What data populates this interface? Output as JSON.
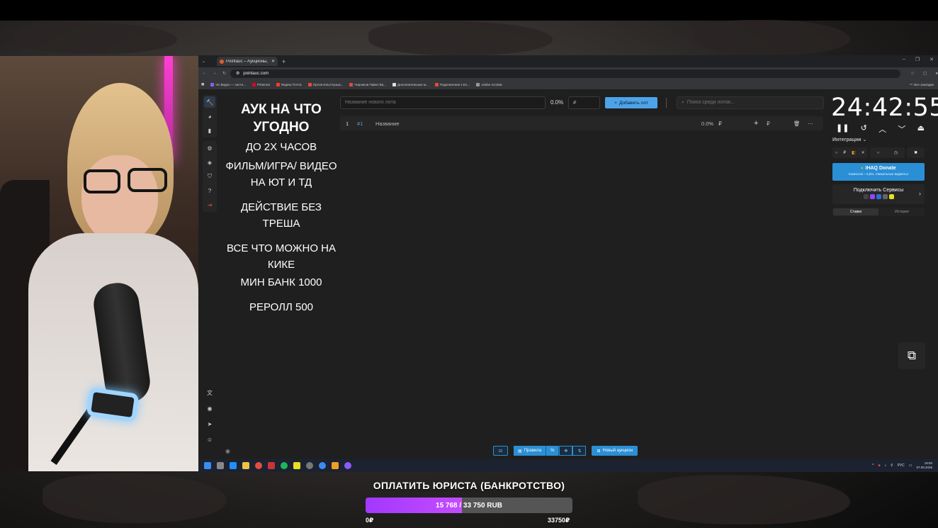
{
  "browser": {
    "tab_title": "Pointauc – Аукционы, созда...",
    "new_tab": "+",
    "url": "pointauc.com",
    "bookmarks": [
      "VK Видео — систе...",
      "Pinterest",
      "Яндекс Почта",
      "Орлов Илья Кузьм...",
      "Черников Павел Ва...",
      "Дополнительные м...",
      "Подключение к Ел...",
      "Adobe Acrobat"
    ],
    "bookmarks_right": "Все закладки"
  },
  "rules": {
    "title": "АУК НА ЧТО УГОДНО",
    "line1": "ДО 2Х ЧАСОВ",
    "line2": "ФИЛЬМ/ИГРА/ ВИДЕО НА ЮТ И ТД",
    "line3": "ДЕЙСТВИЕ БЕЗ ТРЕША",
    "line4": "ВСЕ ЧТО МОЖНО НА КИКЕ",
    "line5": "МИН БАНК 1000",
    "line6": "РЕРОЛЛ 500"
  },
  "toolbar": {
    "lot_placeholder": "Название нового лота",
    "percent": "0.0%",
    "amount_placeholder": "₽",
    "add_lot": "Добавить лот",
    "search_placeholder": "Поиск среди лотов..."
  },
  "lot": {
    "num": "1",
    "id": "#1",
    "name": "Название",
    "percent": "0.0%",
    "currency": "₽",
    "currency2": "₽"
  },
  "timer": {
    "value": "24:42:55"
  },
  "integrations": {
    "label": "Интеграции",
    "pill1": "₽",
    "donate_title": "IHAQ Donate",
    "donate_sub": "Комиссия – 5,5%. Уникальные виджеты!",
    "connect_title": "Подключить Сервисы",
    "tab_bids": "Ставки",
    "tab_history": "История"
  },
  "bottom": {
    "rules": "Правила",
    "new_auction": "Новый аукцион"
  },
  "taskbar": {
    "lang": "РУС",
    "time": "19:50",
    "date": "07.09.2026"
  },
  "goal": {
    "title": "ОПЛАТИТЬ ЮРИСТА (БАНКРОТСТВО)",
    "progress_text": "15 768 / 33 750 RUB",
    "current": 15768,
    "target": 33750,
    "min_label": "0₽",
    "max_label": "33750₽",
    "fill_color": "#a238ff"
  }
}
